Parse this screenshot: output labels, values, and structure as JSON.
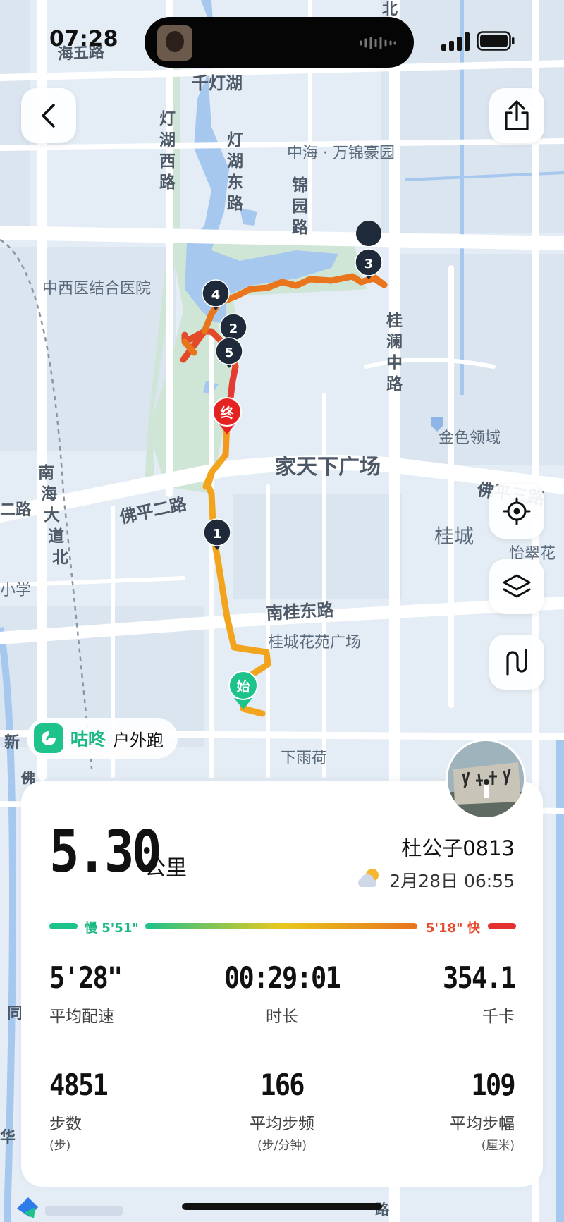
{
  "status_bar": {
    "time": "07:28"
  },
  "map": {
    "labels": {
      "hai_wu": "海五路",
      "qiandeng_hu": "千灯湖",
      "denghu_xi_1": "灯",
      "denghu_xi_2": "湖",
      "denghu_xi_3": "西",
      "denghu_xi_4": "路",
      "denghu_dong_1": "灯",
      "denghu_dong_2": "湖",
      "denghu_dong_3": "东",
      "denghu_dong_4": "路",
      "zhonghai": "中海 · 万锦豪园",
      "jinyuan_1": "锦",
      "jinyuan_2": "园",
      "jinyuan_3": "路",
      "hospital": "中西医结合医院",
      "guilan_1": "桂",
      "guilan_2": "澜",
      "guilan_3": "中",
      "guilan_4": "路",
      "jinse": "金色领域",
      "jiatianxia": "家天下广场",
      "nanhai_1": "南",
      "nanhai_2": "海",
      "nanhai_3": "大",
      "nanhai_4": "道",
      "nanhai_5": "北",
      "foping_er": "佛平二路",
      "foping_san": "佛平三路",
      "er_lu": "二路",
      "guicheng": "桂城",
      "yicuihua": "怡翠花",
      "xiaoxue": "小学",
      "nangui_dong": "南桂东路",
      "guicheng_huayuan": "桂城花苑广场",
      "xiayuhe": "下雨荷",
      "xin": "新",
      "tong": "同",
      "hua": "华",
      "bei_top": "北",
      "fo": "佛",
      "lu_bottom": "路"
    },
    "markers": {
      "m1": "1",
      "m2": "2",
      "m3": "3",
      "m4": "4",
      "m5": "5",
      "start": "始",
      "end": "终"
    }
  },
  "colors": {
    "route_orange": "#f0a020",
    "route_red": "#e53030",
    "green": "#1ec28b",
    "marker_dark": "#1e2a3a"
  },
  "brand": {
    "name": "咕咚",
    "type": "户外跑"
  },
  "summary": {
    "distance": "5.30",
    "distance_unit": "公里",
    "user": "杜公子0813",
    "datetime": "2月28日 06:55"
  },
  "pace_scale": {
    "slow_label": "慢 5'51\"",
    "fast_label": "5'18\" 快"
  },
  "stats": {
    "avg_pace": {
      "value": "5'28\"",
      "label": "平均配速"
    },
    "duration": {
      "value": "00:29:01",
      "label": "时长"
    },
    "calories": {
      "value": "354.1",
      "label": "千卡"
    },
    "steps": {
      "value": "4851",
      "label": "步数",
      "unit": "(步)"
    },
    "cadence": {
      "value": "166",
      "label": "平均步频",
      "unit": "(步/分钟)"
    },
    "stride": {
      "value": "109",
      "label": "平均步幅",
      "unit": "(厘米)"
    }
  }
}
